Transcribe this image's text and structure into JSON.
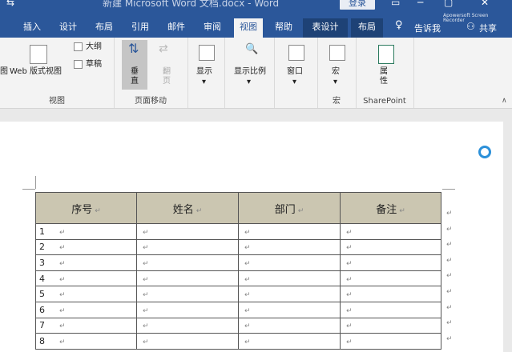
{
  "titlebar": {
    "title": "新建 Microsoft Word 文档.docx  -  Word",
    "login": "登录"
  },
  "tabs": [
    "插入",
    "设计",
    "布局",
    "引用",
    "邮件",
    "审阅",
    "视图",
    "帮助",
    "表设计",
    "布局"
  ],
  "tell_me": "告诉我",
  "share": "共享",
  "ribbon": {
    "view_group": {
      "web": "Web 版式视图",
      "outline": "大纲",
      "draft": "草稿",
      "label": "视图",
      "partial": "图"
    },
    "page_move": {
      "vertical": "垂直",
      "side": "翻页",
      "label": "页面移动"
    },
    "show": "显示",
    "zoom": "显示比例",
    "window": "窗口",
    "macro": "宏",
    "macro_label": "宏",
    "properties": "属性",
    "sharepoint_label": "SharePoint"
  },
  "recorder": "Apowersoft Screen Recorder",
  "table": {
    "headers": [
      "序号",
      "姓名",
      "部门",
      "备注"
    ],
    "rows": [
      "1",
      "2",
      "3",
      "4",
      "5",
      "6",
      "7",
      "8"
    ],
    "mark": "↵"
  }
}
